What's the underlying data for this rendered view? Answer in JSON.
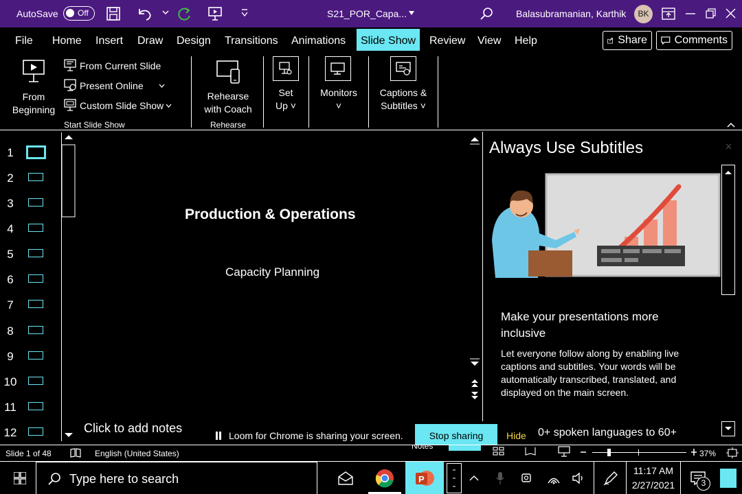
{
  "titlebar": {
    "autosave_label": "AutoSave",
    "autosave_state": "Off",
    "document_name": "S21_POR_Capa...",
    "user_name": "Balasubramanian, Karthik",
    "user_initials": "BK"
  },
  "tabs": [
    "File",
    "Home",
    "Insert",
    "Draw",
    "Design",
    "Transitions",
    "Animations",
    "Slide Show",
    "Review",
    "View",
    "Help"
  ],
  "active_tab": "Slide Show",
  "share_label": "Share",
  "comments_label": "Comments",
  "ribbon": {
    "from_beginning": [
      "From",
      "Beginning"
    ],
    "from_current": "From Current Slide",
    "present_online": "Present Online",
    "custom_show": "Custom Slide Show",
    "group_start": "Start Slide Show",
    "rehearse": [
      "Rehearse",
      "with Coach"
    ],
    "group_rehearse": "Rehearse",
    "setup": [
      "Set",
      "Up"
    ],
    "monitors": "Monitors",
    "captions": [
      "Captions &",
      "Subtitles"
    ]
  },
  "thumbnails": [
    "1",
    "2",
    "3",
    "4",
    "5",
    "6",
    "7",
    "8",
    "9",
    "10",
    "11",
    "12"
  ],
  "selected_slide": 1,
  "slide": {
    "title": "Production & Operations",
    "subtitle": "Capacity Planning"
  },
  "notes_placeholder": "Click to add notes",
  "pane": {
    "title": "Always Use Subtitles",
    "heading": "Make your presentations more inclusive",
    "body": "Let everyone follow along by enabling live captions and subtitles. Your words will be automatically transcribed, translated, and displayed on the main screen.",
    "more": "0+ spoken languages to 60+"
  },
  "share_bar": {
    "message": "Loom for Chrome is sharing your screen.",
    "stop": "Stop sharing",
    "hide": "Hide"
  },
  "status": {
    "slide_count": "Slide 1 of 48",
    "language": "English (United States)",
    "notes": "Notes",
    "zoom": "37%",
    "zoom_level": 0.37
  },
  "taskbar": {
    "search_placeholder": "Type here to search",
    "time": "11:17 AM",
    "date": "2/27/2021",
    "notification_count": "3"
  },
  "colors": {
    "titlebar": "#4b1a7f",
    "accent": "#6ae7f2",
    "hide_link": "#f5d547",
    "powerpoint": "#d35230"
  }
}
